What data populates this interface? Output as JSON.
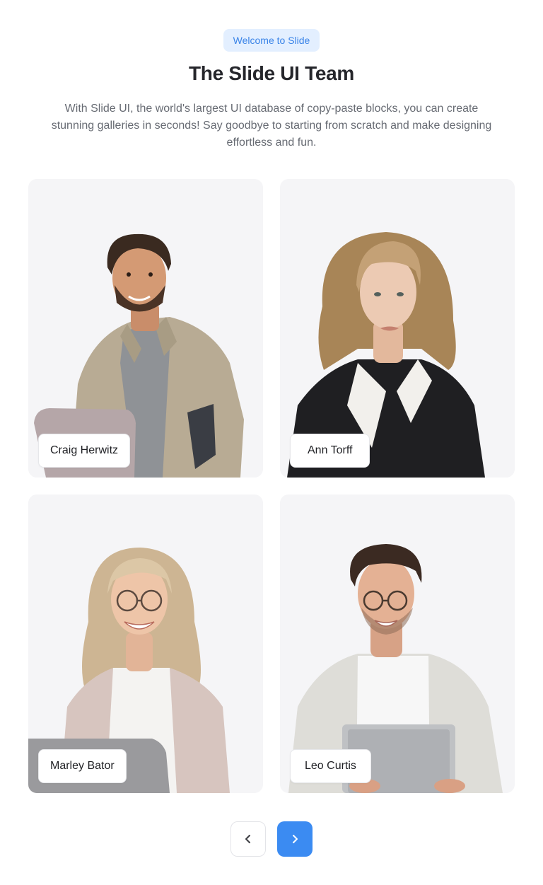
{
  "header": {
    "badge": "Welcome to Slide",
    "title": "The Slide UI Team",
    "subtitle": "With Slide UI, the world's largest UI database of copy-paste blocks, you can create stunning galleries in seconds! Say goodbye to starting from scratch and make designing effortless and fun."
  },
  "team": [
    {
      "name": "Craig Herwitz"
    },
    {
      "name": "Ann Torff"
    },
    {
      "name": "Marley Bator"
    },
    {
      "name": "Leo Curtis"
    }
  ],
  "navigation": {
    "prev_icon": "chevron-left-icon",
    "next_icon": "chevron-right-icon",
    "accent_color": "#3b8bf2"
  }
}
